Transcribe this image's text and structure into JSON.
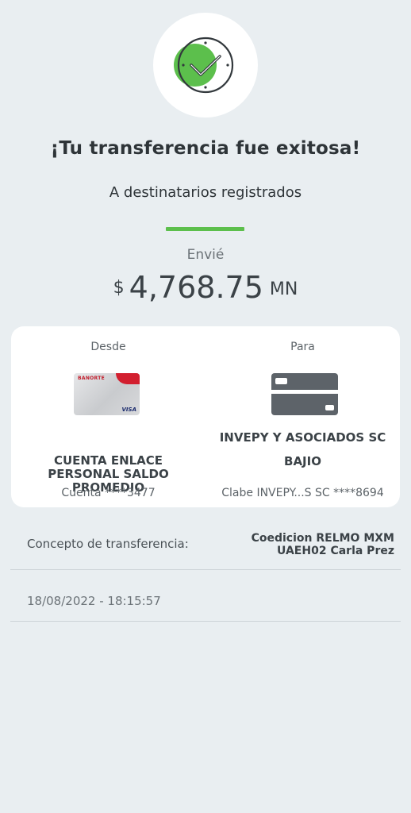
{
  "header": {
    "title": "¡Tu transferencia fue exitosa!",
    "subtitle": "A destinatarios registrados",
    "success_icon": "check-clock-icon"
  },
  "amount": {
    "label": "Envié",
    "currency_symbol": "$",
    "value": "4,768.75",
    "currency_code": "MN"
  },
  "transfer": {
    "from": {
      "label": "Desde",
      "card_image": "banorte-enlace-visa-card",
      "card_brand": "BANORTE",
      "card_network": "VISA",
      "account_name": "CUENTA ENLACE PERSONAL SALDO PROMEDIO",
      "account_number": "Cuenta ****3477"
    },
    "to": {
      "label": "Para",
      "card_image": "generic-card-icon",
      "recipient_name": "INVEPY Y ASOCIADOS SC BAJIO",
      "account_number": "Clabe INVEPY...S SC ****8694"
    }
  },
  "details": {
    "concept_label": "Concepto de transferencia:",
    "concept_value": "Coedicion RELMO MXM UAEH02 Carla Prez",
    "datetime": "18/08/2022 - 18:15:57"
  },
  "colors": {
    "accent_green": "#5cbf4c",
    "background": "#e9eef1",
    "text_dark": "#2e3438"
  }
}
